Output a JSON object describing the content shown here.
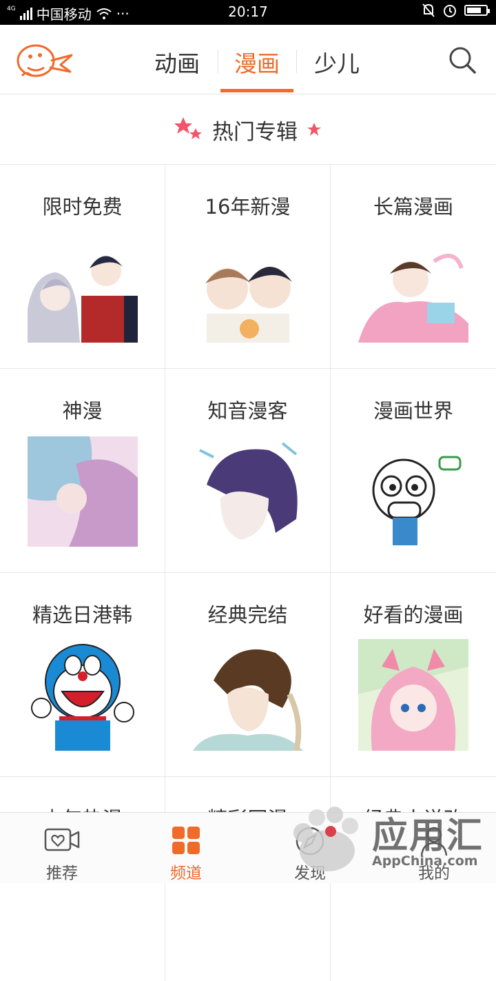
{
  "status_bar": {
    "network_type": "4G",
    "carrier": "中国移动",
    "more": "···",
    "time": "20:17",
    "battery_level": 0.75
  },
  "header": {
    "tabs": [
      {
        "label": "动画",
        "active": false
      },
      {
        "label": "漫画",
        "active": true
      },
      {
        "label": "少儿",
        "active": false
      }
    ]
  },
  "section": {
    "title": "热门专辑"
  },
  "albums": [
    {
      "label": "限时免费"
    },
    {
      "label": "16年新漫"
    },
    {
      "label": "长篇漫画"
    },
    {
      "label": "神漫"
    },
    {
      "label": "知音漫客"
    },
    {
      "label": "漫画世界"
    },
    {
      "label": "精选日港韩"
    },
    {
      "label": "经典完结"
    },
    {
      "label": "好看的漫画"
    },
    {
      "label": "少年热漫"
    },
    {
      "label": "精彩同漫"
    },
    {
      "label": "经典小说改"
    }
  ],
  "bottom_nav": [
    {
      "label": "推荐",
      "icon": "tv-heart-icon",
      "active": false
    },
    {
      "label": "频道",
      "icon": "grid-squares-icon",
      "active": true
    },
    {
      "label": "发现",
      "icon": "compass-icon",
      "active": false
    },
    {
      "label": "我的",
      "icon": "person-icon",
      "active": false
    }
  ],
  "watermark": {
    "text": "应用汇",
    "subtext": "AppChina.com"
  },
  "colors": {
    "accent": "#f06a2a",
    "star": "#f0566a"
  }
}
